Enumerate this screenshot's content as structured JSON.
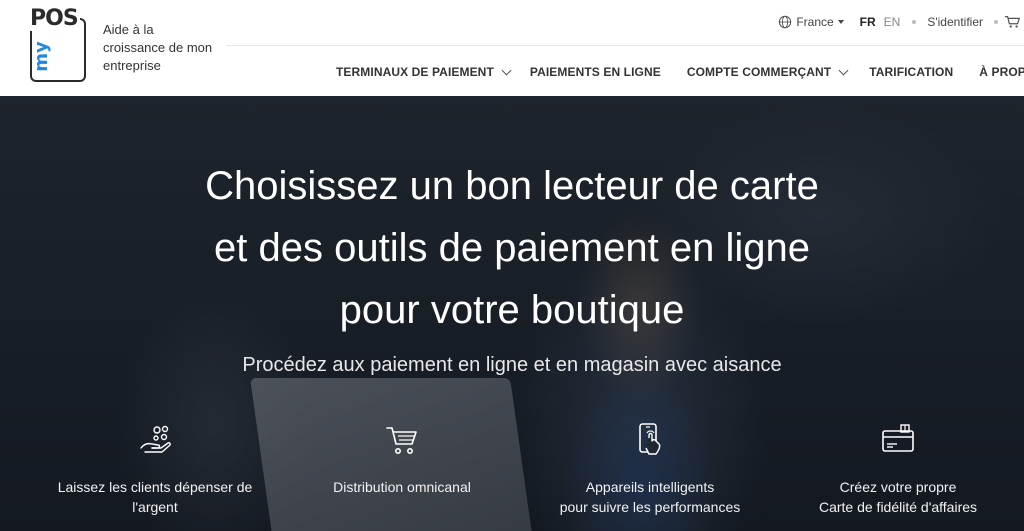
{
  "logo": {
    "pos": "POS",
    "my": "my"
  },
  "tagline": "Aide à la croissance de mon entreprise",
  "utility": {
    "country": "France",
    "lang_fr": "FR",
    "lang_en": "EN",
    "signin": "S'identifier"
  },
  "nav": {
    "items": [
      {
        "label": "TERMINAUX DE PAIEMENT",
        "dropdown": true
      },
      {
        "label": "PAIEMENTS EN LIGNE",
        "dropdown": false
      },
      {
        "label": "COMPTE COMMERÇANT",
        "dropdown": true
      },
      {
        "label": "TARIFICATION",
        "dropdown": false
      },
      {
        "label": "À PROPOS",
        "dropdown": true
      }
    ]
  },
  "hero": {
    "title_line1": "Choisissez un bon lecteur de carte",
    "title_line2": "et des outils de paiement en ligne",
    "title_line3": "pour votre boutique",
    "subtitle": "Procédez aux paiement en ligne et en magasin avec aisance"
  },
  "features": [
    {
      "icon": "hand-coins-icon",
      "line1": "Laissez les clients dépenser de",
      "line2": "l'argent"
    },
    {
      "icon": "shopping-cart-icon",
      "line1": "Distribution omnicanal",
      "line2": ""
    },
    {
      "icon": "smartphone-touch-icon",
      "line1": "Appareils intelligents",
      "line2": "pour suivre les performances"
    },
    {
      "icon": "loyalty-card-icon",
      "line1": "Créez votre propre",
      "line2": "Carte de fidélité d'affaires"
    }
  ],
  "colors": {
    "brand_blue": "#1e88e5",
    "text_dark": "#333333"
  }
}
